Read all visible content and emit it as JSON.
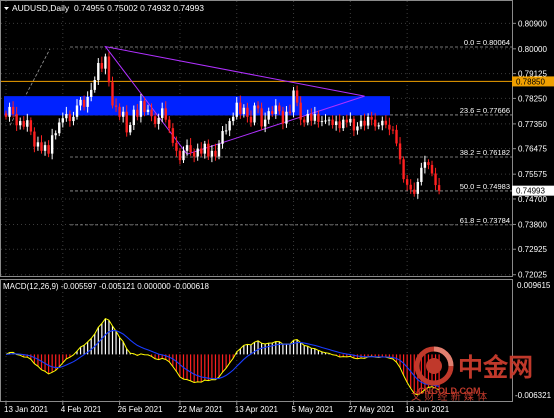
{
  "colors": {
    "background": "#000000",
    "grid": "#3c3c3c",
    "frame": "#8a8a8a",
    "text": "#ffffff",
    "bull_candle": "#ffffff",
    "bear_candle": "#ff2020",
    "resistance_line": "#f0a000",
    "band": "#0022ff",
    "triangle": "#b030ff",
    "fib": "#9a9a9a",
    "macd_line": "#ffff00",
    "signal_line": "#1a3cff",
    "hist_pos": "#ffffff",
    "hist_neg": "#ff2020",
    "price_marker_bg": "#ffffff",
    "resistance_marker_bg": "#f0a000",
    "watermark": "#c0392b"
  },
  "header": {
    "title": "AUDUSD,Daily",
    "ohlc": "0.74955 0.75002 0.74932 0.74993"
  },
  "price_axis": {
    "ticks": [
      "0.80900",
      "0.80000",
      "0.79125",
      "0.78250",
      "0.77350",
      "0.76475",
      "0.75575",
      "0.74700",
      "0.73800",
      "0.72925",
      "0.72025"
    ],
    "tick_values": [
      0.809,
      0.8,
      0.79125,
      0.7825,
      0.7735,
      0.76475,
      0.75575,
      0.747,
      0.738,
      0.72925,
      0.72025
    ],
    "resistance_label": "0.78850",
    "resistance_value": 0.7885,
    "last_price_label": "0.74993",
    "last_price_value": 0.74993,
    "range": [
      0.7198,
      0.8123
    ]
  },
  "fib_levels": [
    {
      "label": "0.0 = 0.80064",
      "value": 0.80064
    },
    {
      "label": "23.6 = 0.77666",
      "value": 0.77666
    },
    {
      "label": "38.2 = 0.76182",
      "value": 0.76182
    },
    {
      "label": "50.0 = 0.74983",
      "value": 0.74983
    },
    {
      "label": "61.8 = 0.73784",
      "value": 0.73784
    }
  ],
  "band": {
    "low": 0.7765,
    "high": 0.7833
  },
  "macd_panel": {
    "label": "MACD(12,26,9) -0.005597 -0.005121 0.000000 -0.000618",
    "top_label": "0.009615",
    "bottom_label": "-0.006321",
    "range": [
      -0.0071,
      0.0105
    ]
  },
  "time_axis": {
    "labels": [
      "13 Jan 2021",
      "4 Feb 2021",
      "26 Feb 2021",
      "22 Mar 2021",
      "13 Apr 2021",
      "5 May 2021",
      "27 May 2021",
      "18 Jun 2021"
    ],
    "label_bars": [
      0,
      16,
      32,
      49,
      65,
      81,
      97,
      113
    ]
  },
  "watermark": {
    "brand": "中金网",
    "domain": "CNGOLD.COM",
    "tagline": "中 文 财 经 新 媒 体"
  },
  "chart_data": {
    "type": "candlestick",
    "title": "AUDUSD,Daily",
    "close_series": [
      0.776,
      0.7795,
      0.777,
      0.773,
      0.7745,
      0.7725,
      0.7748,
      0.7708,
      0.7655,
      0.767,
      0.764,
      0.766,
      0.763,
      0.7695,
      0.7702,
      0.774,
      0.7755,
      0.777,
      0.7745,
      0.776,
      0.78,
      0.782,
      0.7795,
      0.783,
      0.7855,
      0.789,
      0.795,
      0.793,
      0.7973,
      0.7882,
      0.78,
      0.7795,
      0.776,
      0.7778,
      0.7705,
      0.7731,
      0.7785,
      0.776,
      0.7816,
      0.7777,
      0.7785,
      0.7762,
      0.7735,
      0.7756,
      0.779,
      0.775,
      0.772,
      0.7668,
      0.764,
      0.7607,
      0.764,
      0.766,
      0.7635,
      0.762,
      0.7648,
      0.763,
      0.7665,
      0.762,
      0.764,
      0.762,
      0.7665,
      0.771,
      0.7712,
      0.7745,
      0.776,
      0.781,
      0.777,
      0.7792,
      0.776,
      0.774,
      0.78,
      0.779,
      0.7726,
      0.775,
      0.778,
      0.777,
      0.78,
      0.778,
      0.7736,
      0.7778,
      0.7776,
      0.7853,
      0.781,
      0.775,
      0.774,
      0.777,
      0.7746,
      0.777,
      0.7742,
      0.7745,
      0.7747,
      0.775,
      0.7731,
      0.7744,
      0.772,
      0.775,
      0.774,
      0.7753,
      0.7712,
      0.7726,
      0.7746,
      0.7729,
      0.776,
      0.775,
      0.7726,
      0.773,
      0.7746,
      0.7732,
      0.7715,
      0.7714,
      0.7666,
      0.761,
      0.754,
      0.752,
      0.7503,
      0.7488,
      0.753,
      0.758,
      0.76,
      0.759,
      0.756,
      0.7519,
      0.7499
    ],
    "resistance": 0.7885,
    "fibonacci": [
      0.80064,
      0.77666,
      0.76182,
      0.74983,
      0.73784
    ],
    "macd_last": {
      "macd": -0.005597,
      "signal": -0.005121
    }
  }
}
